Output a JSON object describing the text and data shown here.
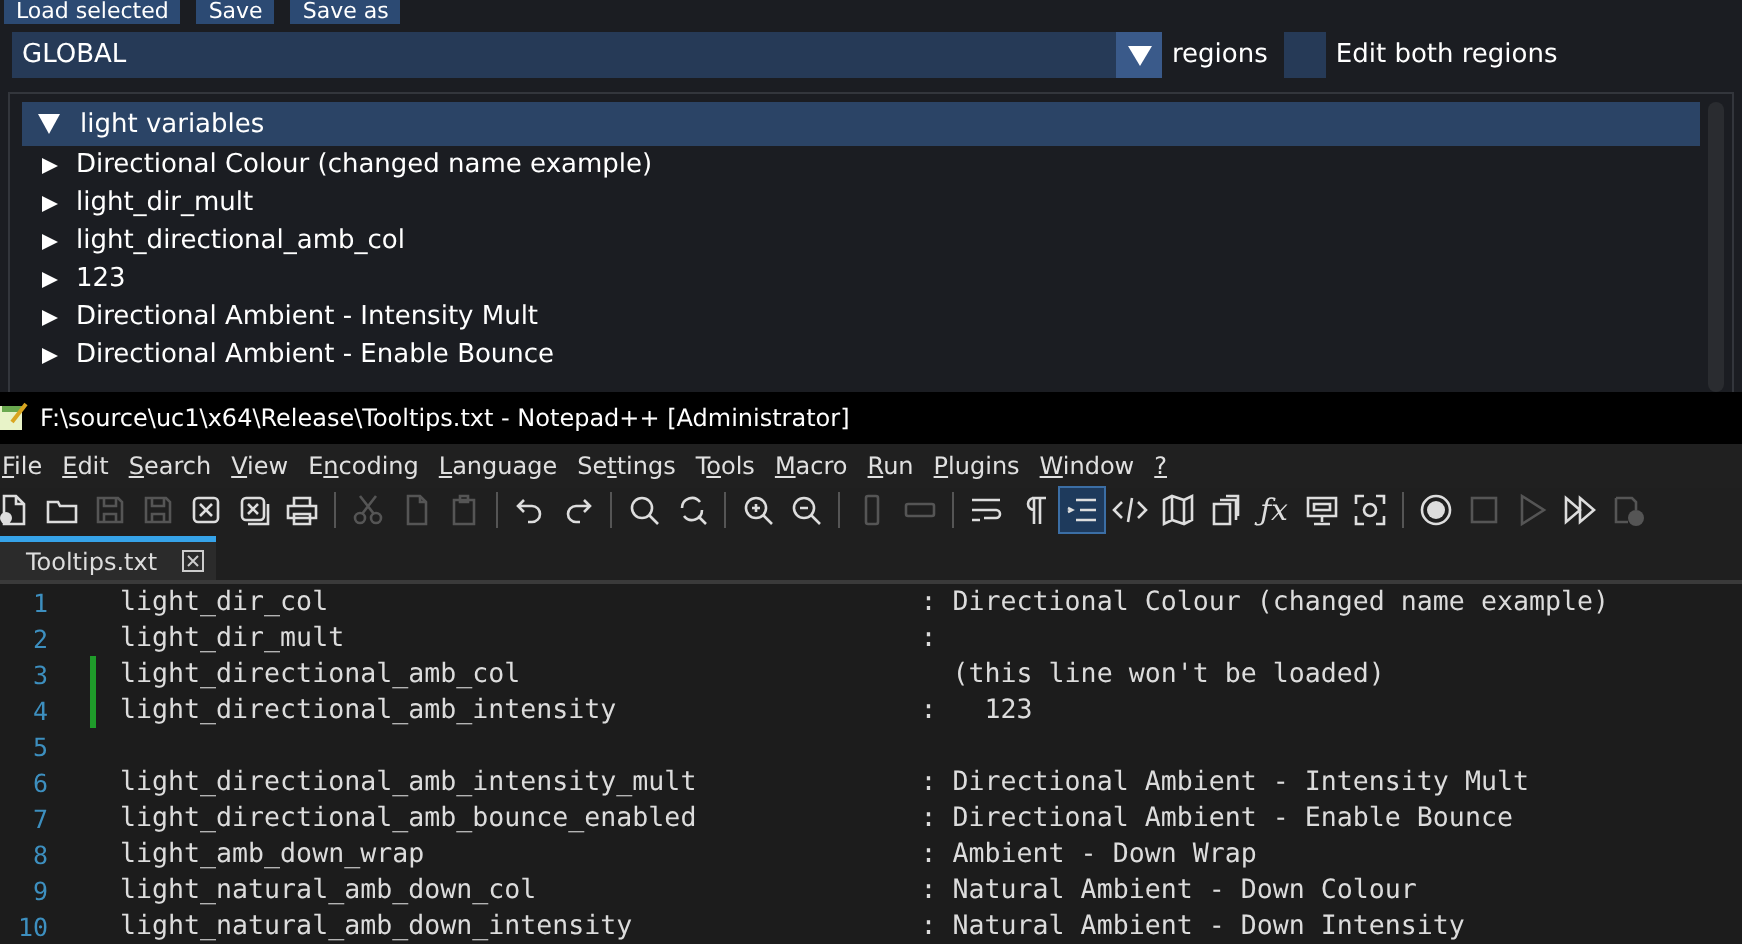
{
  "top_buttons": [
    "Load selected",
    "Save",
    "Save as"
  ],
  "region_combo": {
    "value": "GLOBAL",
    "label": "regions"
  },
  "edit_both": {
    "label": "Edit both regions",
    "checked": false
  },
  "tree": {
    "label": "light variables",
    "expanded": true,
    "children": [
      {
        "label": "Directional Colour (changed name example)",
        "expanded": false
      },
      {
        "label": "light_dir_mult",
        "expanded": false
      },
      {
        "label": "light_directional_amb_col",
        "expanded": false
      },
      {
        "label": "123",
        "expanded": false
      },
      {
        "label": "Directional Ambient - Intensity Mult",
        "expanded": false
      },
      {
        "label": "Directional Ambient - Enable Bounce",
        "expanded": false
      }
    ]
  },
  "window": {
    "title": "F:\\source\\uc1\\x64\\Release\\Tooltips.txt - Notepad++ [Administrator]"
  },
  "menu": [
    {
      "accel": "F",
      "after": "ile"
    },
    {
      "accel": "E",
      "after": "dit"
    },
    {
      "accel": "S",
      "after": "earch"
    },
    {
      "accel": "V",
      "after": "iew"
    },
    {
      "before": "E",
      "accel": "n",
      "after": "coding"
    },
    {
      "accel": "L",
      "after": "anguage"
    },
    {
      "before": "Se",
      "accel": "t",
      "after": "tings"
    },
    {
      "before": "T",
      "accel": "o",
      "after": "ols"
    },
    {
      "accel": "M",
      "after": "acro"
    },
    {
      "accel": "R",
      "after": "un"
    },
    {
      "accel": "P",
      "after": "lugins"
    },
    {
      "accel": "W",
      "after": "indow"
    },
    {
      "accel": "?"
    }
  ],
  "toolbar": [
    {
      "kind": "new",
      "disabled": false,
      "selected": false
    },
    {
      "kind": "open",
      "disabled": false,
      "selected": false
    },
    {
      "kind": "save",
      "disabled": true,
      "selected": false
    },
    {
      "kind": "save",
      "disabled": true,
      "selected": false
    },
    {
      "kind": "close",
      "disabled": false,
      "selected": false
    },
    {
      "kind": "closeall",
      "disabled": false,
      "selected": false
    },
    {
      "kind": "print",
      "disabled": false,
      "selected": false
    },
    {
      "kind": "sep"
    },
    {
      "kind": "cut",
      "disabled": true,
      "selected": false
    },
    {
      "kind": "copy",
      "disabled": true,
      "selected": false
    },
    {
      "kind": "paste",
      "disabled": true,
      "selected": false
    },
    {
      "kind": "sep"
    },
    {
      "kind": "undo",
      "disabled": false,
      "selected": false
    },
    {
      "kind": "redo",
      "disabled": false,
      "selected": false
    },
    {
      "kind": "sep"
    },
    {
      "kind": "find",
      "disabled": false,
      "selected": false
    },
    {
      "kind": "replace",
      "disabled": false,
      "selected": false
    },
    {
      "kind": "sep"
    },
    {
      "kind": "zoomin",
      "disabled": false,
      "selected": false
    },
    {
      "kind": "zoomout",
      "disabled": false,
      "selected": false
    },
    {
      "kind": "sep"
    },
    {
      "kind": "syncv",
      "disabled": true,
      "selected": false
    },
    {
      "kind": "synch",
      "disabled": true,
      "selected": false
    },
    {
      "kind": "sep"
    },
    {
      "kind": "wrap",
      "disabled": false,
      "selected": false
    },
    {
      "kind": "pilcrow",
      "disabled": false,
      "selected": false
    },
    {
      "kind": "indent",
      "disabled": false,
      "selected": true
    },
    {
      "kind": "code",
      "disabled": false,
      "selected": false
    },
    {
      "kind": "map",
      "disabled": false,
      "selected": false
    },
    {
      "kind": "pages",
      "disabled": false,
      "selected": false
    },
    {
      "kind": "fx",
      "label": "ƒx",
      "disabled": false,
      "selected": false
    },
    {
      "kind": "monitor",
      "disabled": false,
      "selected": false
    },
    {
      "kind": "focus",
      "disabled": false,
      "selected": false
    },
    {
      "kind": "sep"
    },
    {
      "kind": "record",
      "disabled": false,
      "selected": false
    },
    {
      "kind": "stop",
      "disabled": true,
      "selected": false
    },
    {
      "kind": "play",
      "disabled": true,
      "selected": false
    },
    {
      "kind": "playmulti",
      "disabled": false,
      "selected": false
    },
    {
      "kind": "savemacro",
      "disabled": true,
      "selected": false
    }
  ],
  "tabs": [
    {
      "label": "Tooltips.txt",
      "selected": true
    }
  ],
  "lines": [
    {
      "number": "1",
      "key": "light_dir_col",
      "sep": ":",
      "value": "Directional Colour (changed name example)",
      "changed": false
    },
    {
      "number": "2",
      "key": "light_dir_mult",
      "sep": ":",
      "changed": false
    },
    {
      "number": "3",
      "key": "light_directional_amb_col",
      "value": "(this line won't be loaded)",
      "changed": true
    },
    {
      "number": "4",
      "key": "light_directional_amb_intensity",
      "sep": ":",
      "value": "  123",
      "changed": true
    },
    {
      "number": "5",
      "changed": false
    },
    {
      "number": "6",
      "key": "light_directional_amb_intensity_mult",
      "sep": ":",
      "value": "Directional Ambient - Intensity Mult",
      "changed": false
    },
    {
      "number": "7",
      "key": "light_directional_amb_bounce_enabled",
      "sep": ":",
      "value": "Directional Ambient - Enable Bounce",
      "changed": false
    },
    {
      "number": "8",
      "key": "light_amb_down_wrap",
      "sep": ":",
      "value": "Ambient - Down Wrap",
      "changed": false
    },
    {
      "number": "9",
      "key": "light_natural_amb_down_col",
      "sep": ":",
      "value": "Natural Ambient - Down Colour",
      "changed": false
    },
    {
      "number": "10",
      "key": "light_natural_amb_down_intensity",
      "sep": ":",
      "value": "Natural Ambient - Down Intensity",
      "changed": false
    }
  ]
}
